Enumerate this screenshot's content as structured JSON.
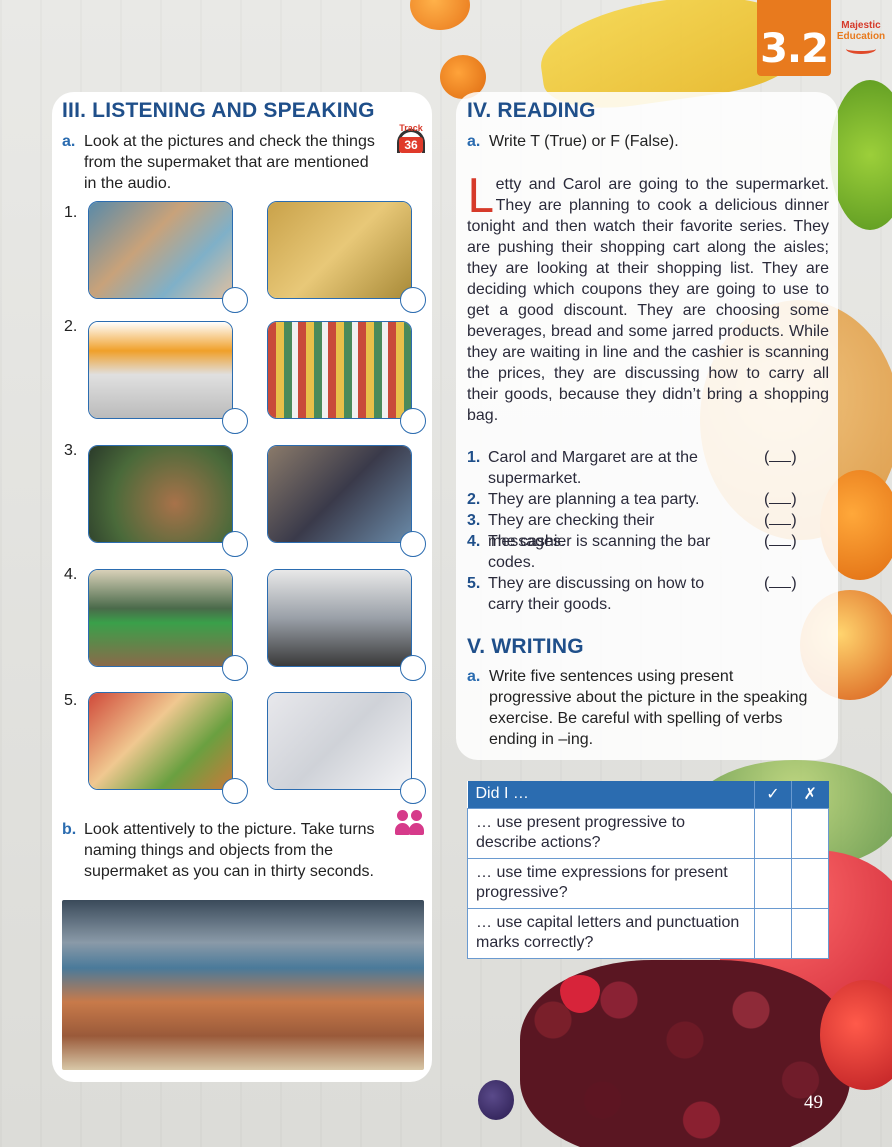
{
  "unit_badge": "3.2",
  "brand": {
    "line1": "Majestic",
    "line2": "Education"
  },
  "listening": {
    "title": "III. LISTENING AND SPEAKING",
    "track_label": "Track",
    "track_number": "36",
    "task_a_letter": "a.",
    "task_a_text": "Look at the pictures and check the things from the supermaket that are mentioned in the audio.",
    "rows": [
      "1.",
      "2.",
      "3.",
      "4.",
      "5."
    ],
    "task_b_letter": "b.",
    "task_b_text": "Look attentively to the picture. Take turns naming things and objects from the supermaket as you can in thirty seconds."
  },
  "reading": {
    "title": "IV. READING",
    "task_a_letter": "a.",
    "task_a_text": "Write T (True) or F (False).",
    "drop_cap": "L",
    "passage": "etty and Carol are going to the supermarket. They are planning to cook a delicious dinner tonight and then watch their favorite series. They are pushing their shopping cart along the aisles; they are looking at their shopping list. They are deciding which coupons they are going to use to get a good discount. They are choosing some beverages, bread and some jarred products. While they are waiting in line and the cashier is scanning the prices, they are discussing how to carry all their goods, because they didn’t bring a shopping bag.",
    "statements": [
      {
        "num": "1.",
        "text": "Carol and Margaret are at the supermarket."
      },
      {
        "num": "2.",
        "text": "They are planning a tea party."
      },
      {
        "num": "3.",
        "text": "They are checking their messages."
      },
      {
        "num": "4.",
        "text": "The cashier is scanning the bar codes."
      },
      {
        "num": "5.",
        "text": "They are discussing on how to carry their goods."
      }
    ]
  },
  "writing": {
    "title": "V. WRITING",
    "task_a_letter": "a.",
    "task_a_text": "Write five sentences using present progressive about the picture in the speaking exercise. Be careful with spelling of verbs ending in –ing."
  },
  "checklist": {
    "header": "Did I …",
    "col_yes": "✓",
    "col_no": "✗",
    "rows": [
      "… use present progressive to describe actions?",
      "… use time expressions for present progressive?",
      "… use capital letters and punctuation marks correctly?"
    ]
  },
  "page_number": "49",
  "colors": {
    "heading": "#1f4f8a",
    "accent": "#2b6cb0",
    "badge": "#e87a1e",
    "drop_cap": "#d63a2a"
  }
}
